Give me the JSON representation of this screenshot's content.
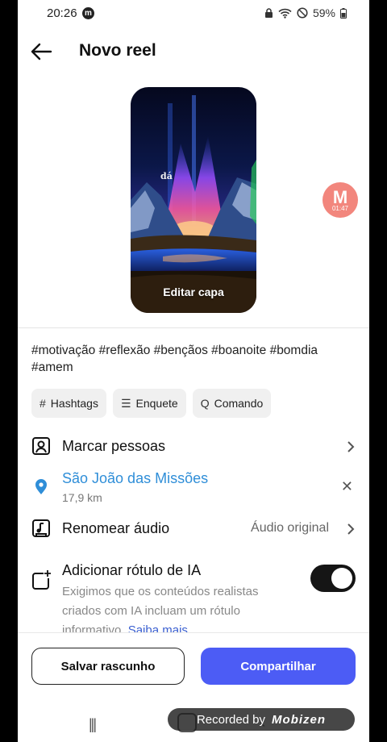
{
  "status_bar": {
    "time": "20:26",
    "app_badge": "m",
    "battery": "59%"
  },
  "header": {
    "title": "Novo reel"
  },
  "cover": {
    "overlay_word": "dá",
    "edit_label": "Editar capa"
  },
  "floating_badge": {
    "letter": "M",
    "time": "01:47"
  },
  "caption": "#motivação #reflexão #bençãos #boanoite #bomdia #amem",
  "chips": [
    {
      "icon": "#",
      "label": "Hashtags"
    },
    {
      "icon": "☰",
      "label": "Enquete"
    },
    {
      "icon": "Q",
      "label": "Comando"
    }
  ],
  "rows": {
    "tag_people": "Marcar pessoas",
    "location": {
      "name": "São João das Missões",
      "distance": "17,9 km"
    },
    "rename_audio": {
      "label": "Renomear áudio",
      "value": "Áudio original"
    },
    "ai_label": {
      "label": "Adicionar rótulo de IA",
      "description": "Exigimos que os conteúdos realistas criados com IA incluam um rótulo informativo.",
      "link": "Saiba mais",
      "toggle_on": true
    }
  },
  "buttons": {
    "save_draft": "Salvar rascunho",
    "share": "Compartilhar"
  },
  "watermark": {
    "text": "Recorded by",
    "logo": "Mobizen"
  },
  "colors": {
    "accent": "#4c5cf5",
    "location_blue": "#2f8ed8",
    "link_blue": "#3a5fd0"
  }
}
